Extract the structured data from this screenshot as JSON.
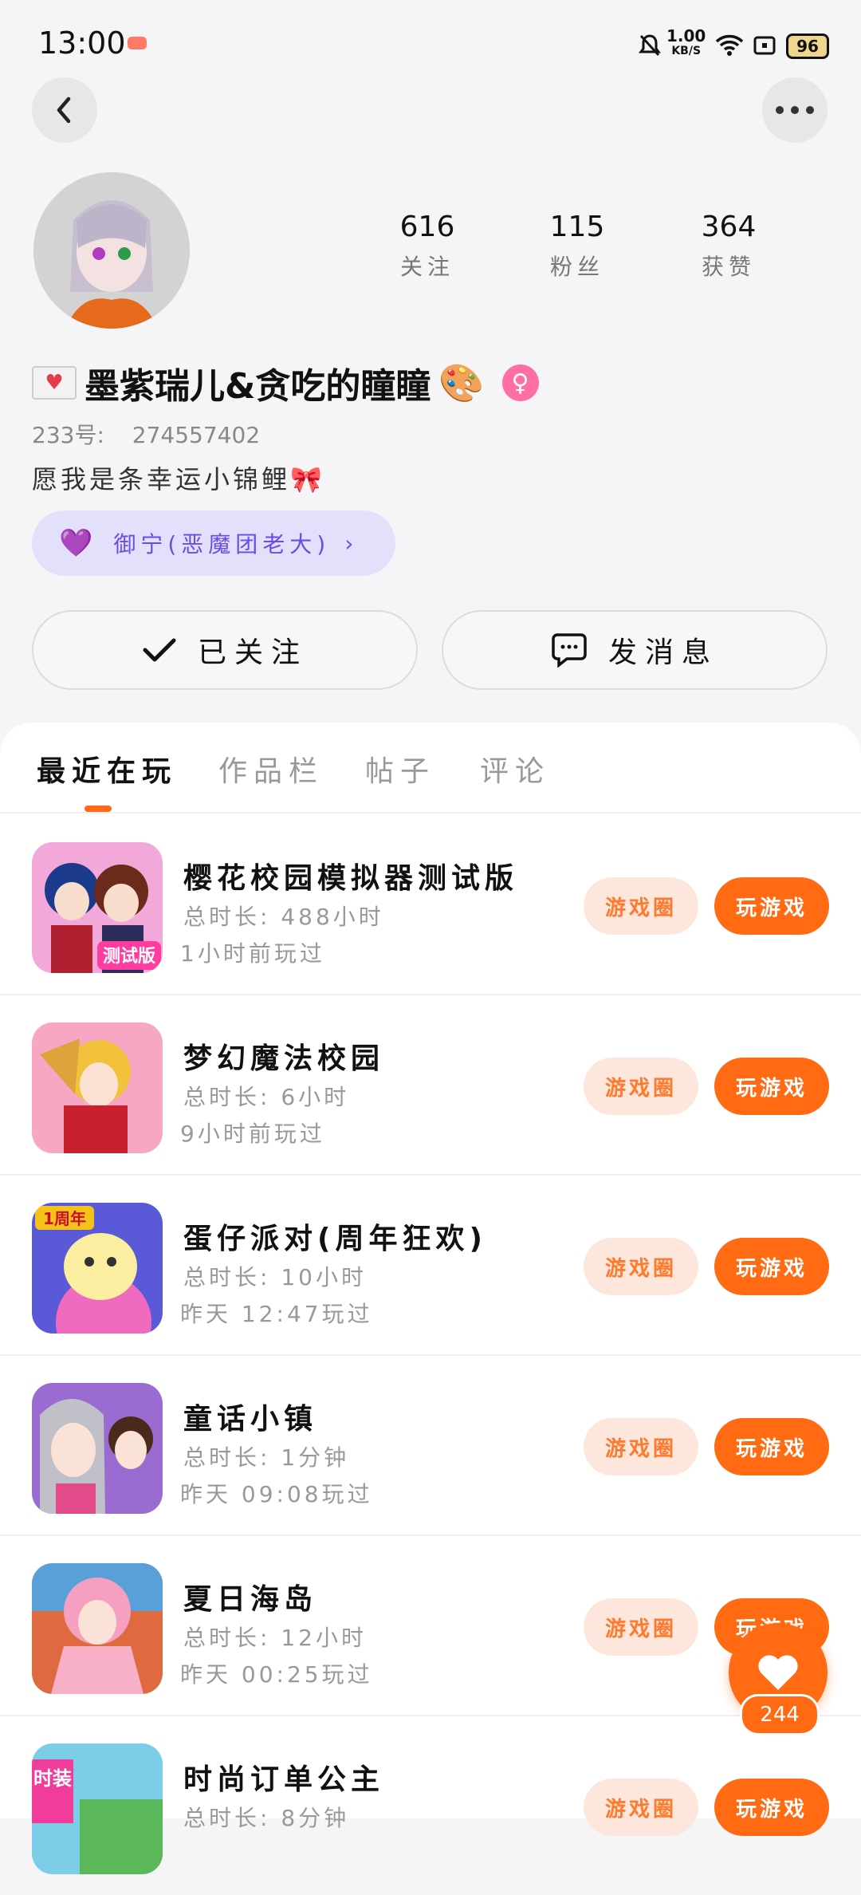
{
  "status_bar": {
    "time": "13:00",
    "net_speed_value": "1.00",
    "net_speed_unit": "KB/S",
    "battery": "96"
  },
  "profile": {
    "stats": [
      {
        "value": "616",
        "label": "关注"
      },
      {
        "value": "115",
        "label": "粉丝"
      },
      {
        "value": "364",
        "label": "获赞"
      }
    ],
    "nickname": "墨紫瑞儿&贪吃的瞳瞳",
    "uid_label": "233号:",
    "uid_value": "274557402",
    "bio": "愿我是条幸运小锦鲤🎀",
    "relation": "御宁(恶魔团老大)"
  },
  "actions": {
    "follow_label": "已关注",
    "message_label": "发消息"
  },
  "tabs": [
    "最近在玩",
    "作品栏",
    "帖子",
    "评论"
  ],
  "games": [
    {
      "name": "樱花校园模拟器测试版",
      "duration_label": "总时长:",
      "duration": "488小时",
      "last_played": "1小时前玩过",
      "icon_text": "测试版"
    },
    {
      "name": "梦幻魔法校园",
      "duration_label": "总时长:",
      "duration": "6小时",
      "last_played": "9小时前玩过",
      "icon_text": ""
    },
    {
      "name": "蛋仔派对(周年狂欢)",
      "duration_label": "总时长:",
      "duration": "10小时",
      "last_played": "昨天 12:47玩过",
      "icon_text": "1周年"
    },
    {
      "name": "童话小镇",
      "duration_label": "总时长:",
      "duration": "1分钟",
      "last_played": "昨天 09:08玩过",
      "icon_text": ""
    },
    {
      "name": "夏日海岛",
      "duration_label": "总时长:",
      "duration": "12小时",
      "last_played": "昨天 00:25玩过",
      "icon_text": ""
    },
    {
      "name": "时尚订单公主",
      "duration_label": "总时长:",
      "duration": "8分钟",
      "last_played": "",
      "icon_text": "时装"
    }
  ],
  "buttons": {
    "circle": "游戏圈",
    "play": "玩游戏"
  },
  "like": {
    "count": "244"
  },
  "colors": {
    "accent": "#ff6a12",
    "relation": "#6b4de6",
    "gender": "#ff6fa5"
  }
}
